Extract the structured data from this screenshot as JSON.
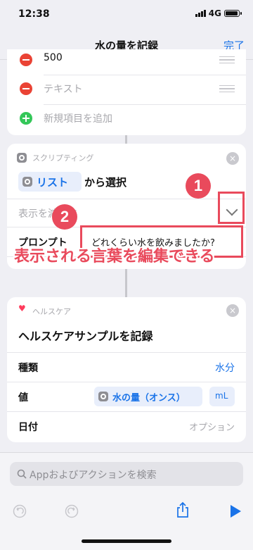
{
  "status": {
    "time": "12:38",
    "network": "4G"
  },
  "nav": {
    "title": "水の量を記録",
    "done": "完了"
  },
  "list_card": {
    "item1": "500",
    "item2": "テキスト",
    "add": "新規項目を追加"
  },
  "script_card": {
    "category": "スクリプティング",
    "action_token": "リスト",
    "action_suffix": "から選択",
    "show_less": "表示を減らす",
    "prompt_label": "プロンプト",
    "prompt_value": "どれくらい水を飲みましたか?"
  },
  "annotations": {
    "badge1": "1",
    "badge2": "2",
    "caption": "表示される言葉を編集できる"
  },
  "health_card": {
    "category": "ヘルスケア",
    "title": "ヘルスケアサンプルを記録",
    "rows": {
      "type_label": "種類",
      "type_value": "水分",
      "value_label": "値",
      "value_token": "水の量（オンス）",
      "value_unit": "mL",
      "date_label": "日付",
      "date_value": "オプション"
    }
  },
  "search": {
    "placeholder": "Appおよびアクションを検索"
  },
  "colors": {
    "accent": "#1a73e8",
    "annotation": "#e94a5c",
    "delete": "#ea4335",
    "add": "#34c759"
  },
  "icons": [
    "undo-icon",
    "redo-icon",
    "share-icon",
    "play-icon",
    "search-icon",
    "gear-icon",
    "heart-icon",
    "chevron-down-icon",
    "close-icon"
  ]
}
